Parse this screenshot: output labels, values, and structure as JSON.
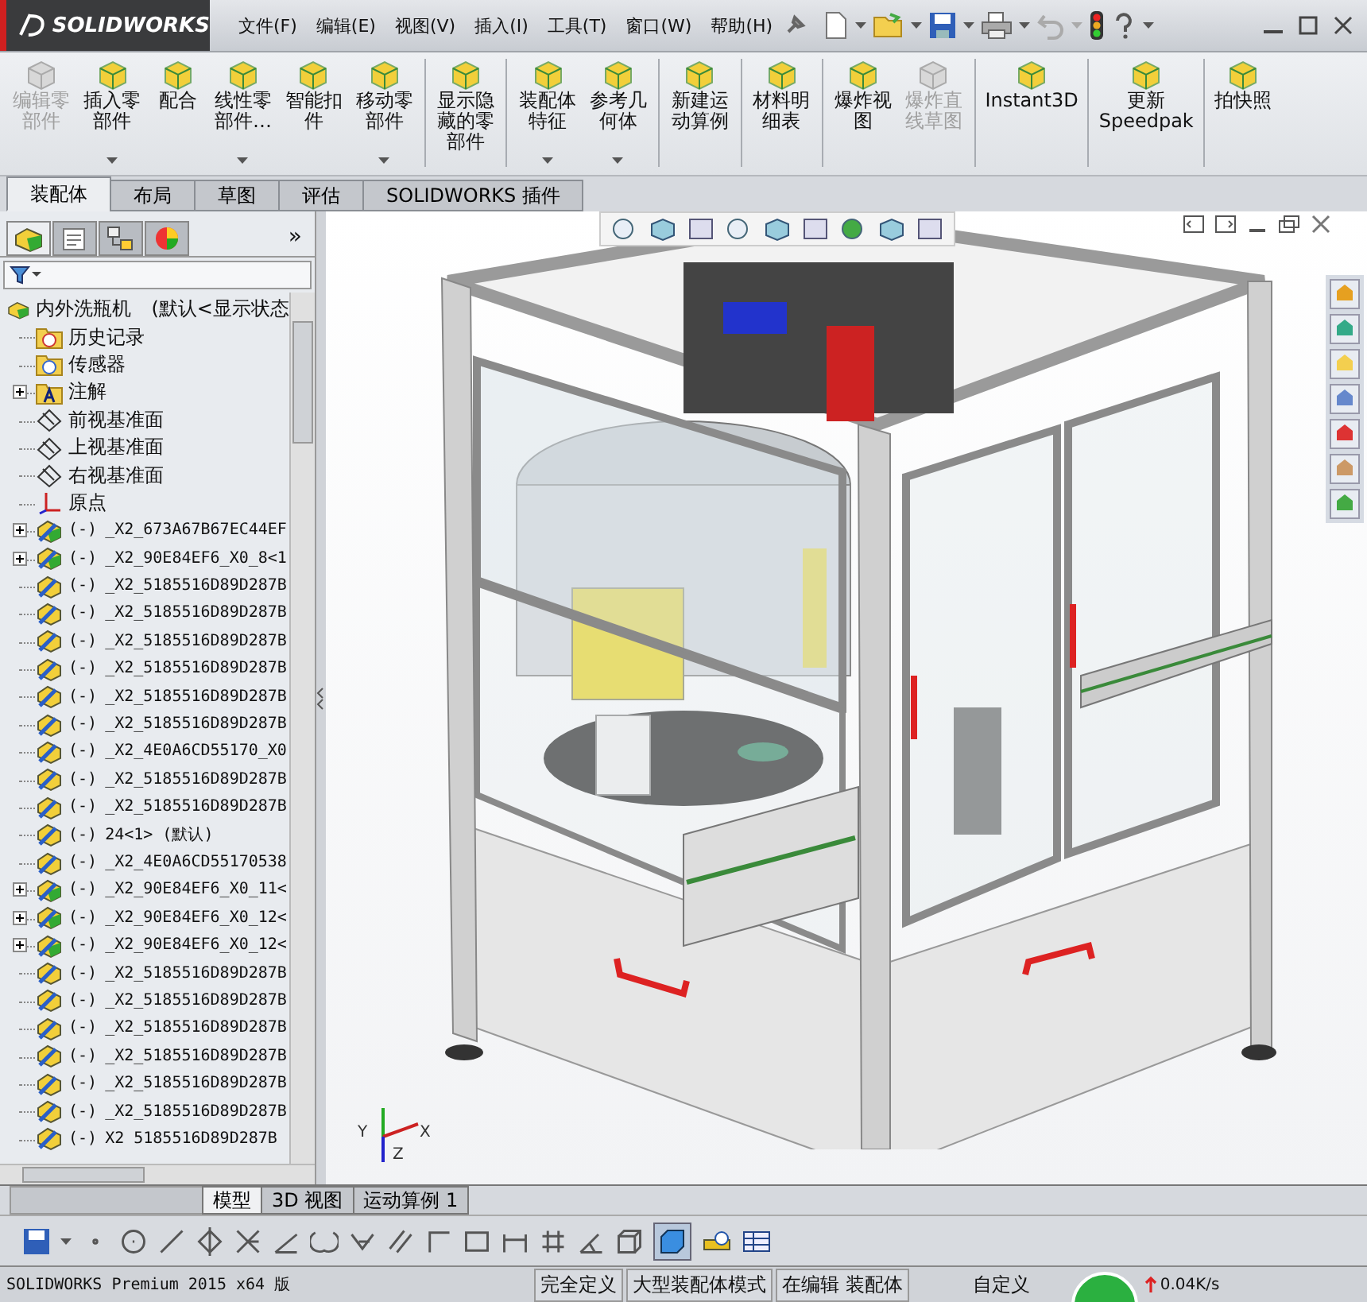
{
  "logo": {
    "brand": "SOLIDWORKS"
  },
  "menu": [
    "文件(F)",
    "编辑(E)",
    "视图(V)",
    "插入(I)",
    "工具(T)",
    "窗口(W)",
    "帮助(H)"
  ],
  "command_buttons": [
    {
      "label": "编辑零部件",
      "disabled": true,
      "dropdown": false,
      "separator_before": false
    },
    {
      "label": "插入零部件",
      "disabled": false,
      "dropdown": true,
      "separator_before": false
    },
    {
      "label": "配合",
      "disabled": false,
      "dropdown": false,
      "separator_before": false
    },
    {
      "label": "线性零部件…",
      "disabled": false,
      "dropdown": true,
      "separator_before": false
    },
    {
      "label": "智能扣件",
      "disabled": false,
      "dropdown": false,
      "separator_before": false
    },
    {
      "label": "移动零部件",
      "disabled": false,
      "dropdown": true,
      "separator_before": false
    },
    {
      "label": "显示隐藏的零部件",
      "disabled": false,
      "dropdown": false,
      "separator_before": true
    },
    {
      "label": "装配体特征",
      "disabled": false,
      "dropdown": true,
      "separator_before": true
    },
    {
      "label": "参考几何体",
      "disabled": false,
      "dropdown": true,
      "separator_before": false
    },
    {
      "label": "新建运动算例",
      "disabled": false,
      "dropdown": false,
      "separator_before": true
    },
    {
      "label": "材料明细表",
      "disabled": false,
      "dropdown": false,
      "separator_before": true
    },
    {
      "label": "爆炸视图",
      "disabled": false,
      "dropdown": false,
      "separator_before": true
    },
    {
      "label": "爆炸直线草图",
      "disabled": true,
      "dropdown": false,
      "separator_before": false
    },
    {
      "label": "Instant3D",
      "disabled": false,
      "dropdown": false,
      "separator_before": true
    },
    {
      "label": "更新Speedpak",
      "disabled": false,
      "dropdown": false,
      "separator_before": true
    },
    {
      "label": "拍快照",
      "disabled": false,
      "dropdown": false,
      "separator_before": true
    }
  ],
  "tabs": [
    {
      "label": "装配体",
      "selected": true
    },
    {
      "label": "布局",
      "selected": false
    },
    {
      "label": "草图",
      "selected": false
    },
    {
      "label": "评估",
      "selected": false
    },
    {
      "label": "SOLIDWORKS 插件",
      "selected": false
    }
  ],
  "panel_tabs": {
    "items": [
      {
        "kind": "feature-tree",
        "selected": true
      },
      {
        "kind": "property",
        "selected": false
      },
      {
        "kind": "configuration",
        "selected": false
      },
      {
        "kind": "appearance",
        "selected": false
      }
    ],
    "more": "»"
  },
  "tree": {
    "root": {
      "label": "内外洗瓶机",
      "configuration": "(默认<显示状态",
      "children": [
        {
          "kind": "history",
          "label": "历史记录"
        },
        {
          "kind": "sensor",
          "label": "传感器"
        },
        {
          "kind": "annotation",
          "label": "注解",
          "expanded": false
        },
        {
          "kind": "plane",
          "label": "前视基准面"
        },
        {
          "kind": "plane",
          "label": "上视基准面"
        },
        {
          "kind": "plane",
          "label": "右视基准面"
        },
        {
          "kind": "origin",
          "label": "原点"
        },
        {
          "kind": "assembly",
          "state": "(-)",
          "label": "_X2_673A67B67EC44EF",
          "expanded": false
        },
        {
          "kind": "assembly",
          "state": "(-)",
          "label": "_X2_90E84EF6_X0_8<1",
          "expanded": false
        },
        {
          "kind": "part",
          "state": "(-)",
          "label": "_X2_5185516D89D287B"
        },
        {
          "kind": "part",
          "state": "(-)",
          "label": "_X2_5185516D89D287B"
        },
        {
          "kind": "part",
          "state": "(-)",
          "label": "_X2_5185516D89D287B"
        },
        {
          "kind": "part",
          "state": "(-)",
          "label": "_X2_5185516D89D287B"
        },
        {
          "kind": "part",
          "state": "(-)",
          "label": "_X2_5185516D89D287B"
        },
        {
          "kind": "part",
          "state": "(-)",
          "label": "_X2_5185516D89D287B"
        },
        {
          "kind": "part",
          "state": "(-)",
          "label": "_X2_4E0A6CD55170_X0"
        },
        {
          "kind": "part",
          "state": "(-)",
          "label": "_X2_5185516D89D287B"
        },
        {
          "kind": "part",
          "state": "(-)",
          "label": "_X2_5185516D89D287B"
        },
        {
          "kind": "part",
          "state": "(-)",
          "label": "24<1> (默认)"
        },
        {
          "kind": "part",
          "state": "(-)",
          "label": "_X2_4E0A6CD55170538"
        },
        {
          "kind": "assembly",
          "state": "(-)",
          "label": "_X2_90E84EF6_X0_11<",
          "expanded": false
        },
        {
          "kind": "assembly",
          "state": "(-)",
          "label": "_X2_90E84EF6_X0_12<",
          "expanded": false
        },
        {
          "kind": "assembly",
          "state": "(-)",
          "label": "_X2_90E84EF6_X0_12<",
          "expanded": false
        },
        {
          "kind": "part",
          "state": "(-)",
          "label": "_X2_5185516D89D287B"
        },
        {
          "kind": "part",
          "state": "(-)",
          "label": "_X2_5185516D89D287B"
        },
        {
          "kind": "part",
          "state": "(-)",
          "label": "_X2_5185516D89D287B"
        },
        {
          "kind": "part",
          "state": "(-)",
          "label": "_X2_5185516D89D287B"
        },
        {
          "kind": "part",
          "state": "(-)",
          "label": "_X2_5185516D89D287B"
        },
        {
          "kind": "part",
          "state": "(-)",
          "label": "_X2_5185516D89D287B"
        },
        {
          "kind": "part",
          "state": "(-)",
          "label": "X2 5185516D89D287B"
        }
      ]
    }
  },
  "viewport": {
    "triad": {
      "y": "Y",
      "x": "X",
      "z": "Z"
    }
  },
  "bottom_tabs": [
    {
      "label": "模型",
      "selected": true
    },
    {
      "label": "3D 视图",
      "selected": false
    },
    {
      "label": "运动算例 1",
      "selected": false
    }
  ],
  "status_bar": {
    "product": "SOLIDWORKS Premium 2015 x64 版",
    "fields": [
      "完全定义",
      "大型装配体模式",
      "在编辑 装配体"
    ],
    "custom": "自定义",
    "network_speed": "0.04K/s"
  }
}
